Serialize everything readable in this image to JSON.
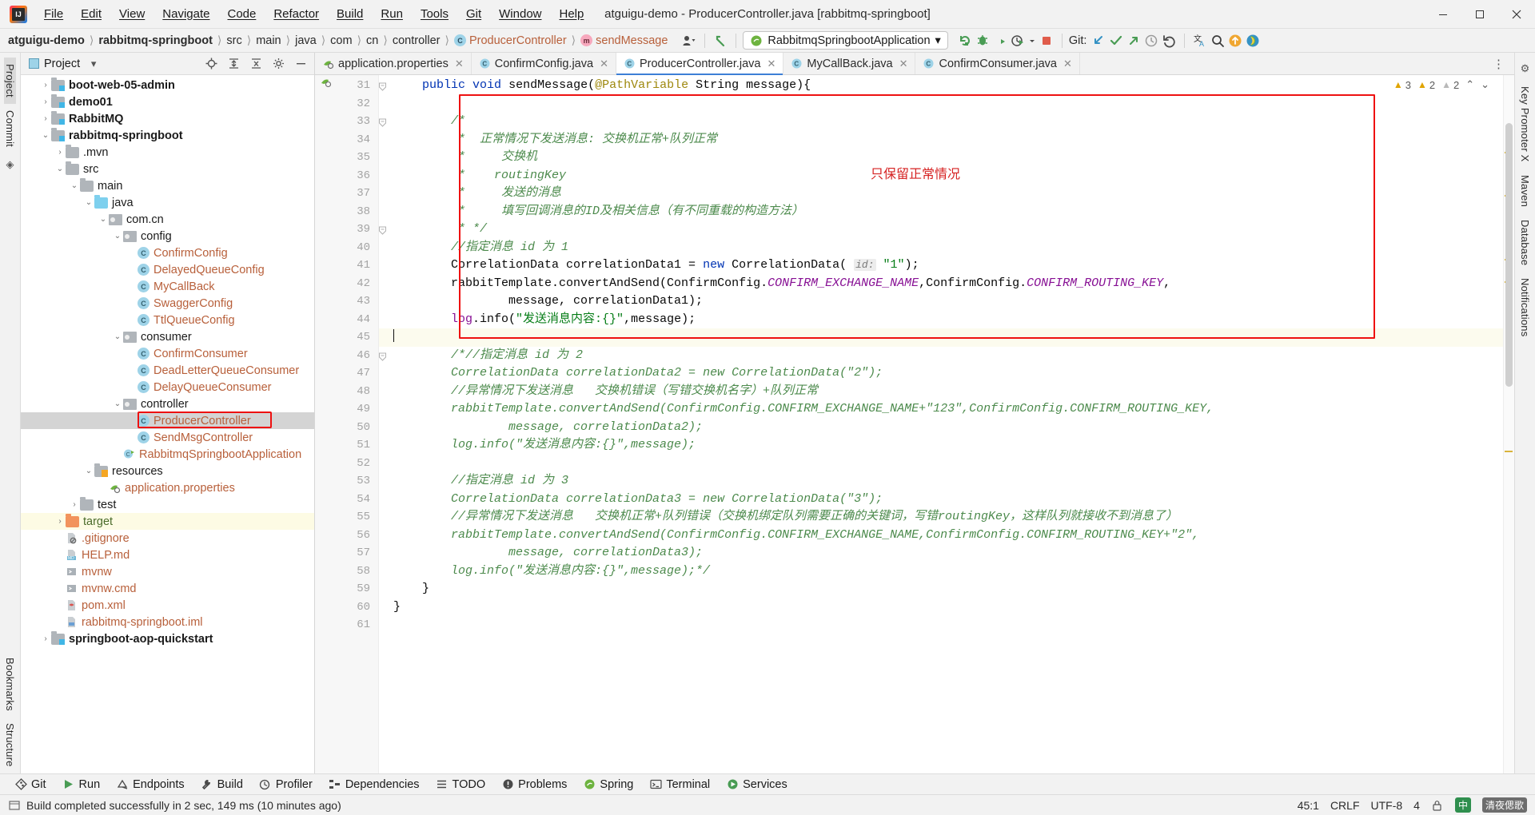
{
  "window": {
    "title": "atguigu-demo - ProducerController.java [rabbitmq-springboot]",
    "minimize": "—",
    "maximize": "☐",
    "close": "✕"
  },
  "menu": [
    {
      "label": "File",
      "mnemonic": "F"
    },
    {
      "label": "Edit",
      "mnemonic": "E"
    },
    {
      "label": "View",
      "mnemonic": "V"
    },
    {
      "label": "Navigate",
      "mnemonic": "N"
    },
    {
      "label": "Code",
      "mnemonic": "C"
    },
    {
      "label": "Refactor",
      "mnemonic": "R"
    },
    {
      "label": "Build",
      "mnemonic": "B"
    },
    {
      "label": "Run",
      "mnemonic": "u"
    },
    {
      "label": "Tools",
      "mnemonic": "T"
    },
    {
      "label": "Git",
      "mnemonic": "G"
    },
    {
      "label": "Window",
      "mnemonic": "W"
    },
    {
      "label": "Help",
      "mnemonic": "H"
    }
  ],
  "breadcrumb": [
    {
      "label": "atguigu-demo",
      "style": "bold"
    },
    {
      "label": "rabbitmq-springboot",
      "style": "bold"
    },
    {
      "label": "src",
      "style": "plain"
    },
    {
      "label": "main",
      "style": "plain"
    },
    {
      "label": "java",
      "style": "plain"
    },
    {
      "label": "com",
      "style": "plain"
    },
    {
      "label": "cn",
      "style": "plain"
    },
    {
      "label": "controller",
      "style": "plain"
    },
    {
      "label": "ProducerController",
      "style": "class"
    },
    {
      "label": "sendMessage",
      "style": "method"
    }
  ],
  "toolbar": {
    "run_config": "RabbitmqSpringbootApplication",
    "run_config_chevron": "▾",
    "git_label": "Git:",
    "icons": [
      "profile-selector-icon",
      "back-arrow-icon",
      "rerun-icon",
      "debug-icon",
      "run-with-coverage-icon",
      "profiler-icon",
      "stop-icon",
      "git-update-icon",
      "git-commit-icon",
      "git-push-icon",
      "git-history-icon",
      "git-rollback-icon",
      "translate-icon",
      "search-everywhere-icon",
      "updates-icon",
      "ide-feature-icon"
    ]
  },
  "left_rail": [
    {
      "label": "Project",
      "selected": true
    },
    {
      "label": "Commit",
      "selected": false
    },
    {
      "label": "Bookmarks",
      "selected": false
    },
    {
      "label": "Structure",
      "selected": false
    }
  ],
  "right_rail": [
    {
      "label": "Key Promoter X"
    },
    {
      "label": "Maven"
    },
    {
      "label": "Database"
    },
    {
      "label": "Notifications"
    }
  ],
  "project_panel": {
    "title": "Project",
    "chevron": "▾",
    "actions": [
      "locate-icon",
      "expand-all-icon",
      "collapse-all-icon",
      "settings-icon",
      "hide-icon"
    ]
  },
  "tree": [
    {
      "depth": 1,
      "arrow": "›",
      "icon": "module",
      "label": "boot-web-05-admin",
      "style": "bold"
    },
    {
      "depth": 1,
      "arrow": "›",
      "icon": "module",
      "label": "demo01",
      "style": "bold"
    },
    {
      "depth": 1,
      "arrow": "›",
      "icon": "module",
      "label": "RabbitMQ",
      "style": "bold"
    },
    {
      "depth": 1,
      "arrow": "⌄",
      "icon": "module",
      "label": "rabbitmq-springboot",
      "style": "bold"
    },
    {
      "depth": 2,
      "arrow": "›",
      "icon": "folder",
      "label": ".mvn",
      "style": "plain"
    },
    {
      "depth": 2,
      "arrow": "⌄",
      "icon": "folder",
      "label": "src",
      "style": "plain"
    },
    {
      "depth": 3,
      "arrow": "⌄",
      "icon": "folder",
      "label": "main",
      "style": "plain"
    },
    {
      "depth": 4,
      "arrow": "⌄",
      "icon": "source",
      "label": "java",
      "style": "plain"
    },
    {
      "depth": 5,
      "arrow": "⌄",
      "icon": "package",
      "label": "com.cn",
      "style": "plain"
    },
    {
      "depth": 6,
      "arrow": "⌄",
      "icon": "package",
      "label": "config",
      "style": "plain"
    },
    {
      "depth": 7,
      "arrow": "",
      "icon": "class",
      "label": "ConfirmConfig",
      "style": "orange"
    },
    {
      "depth": 7,
      "arrow": "",
      "icon": "class",
      "label": "DelayedQueueConfig",
      "style": "orange"
    },
    {
      "depth": 7,
      "arrow": "",
      "icon": "class",
      "label": "MyCallBack",
      "style": "orange"
    },
    {
      "depth": 7,
      "arrow": "",
      "icon": "class",
      "label": "SwaggerConfig",
      "style": "orange"
    },
    {
      "depth": 7,
      "arrow": "",
      "icon": "class",
      "label": "TtlQueueConfig",
      "style": "orange"
    },
    {
      "depth": 6,
      "arrow": "⌄",
      "icon": "package",
      "label": "consumer",
      "style": "plain"
    },
    {
      "depth": 7,
      "arrow": "",
      "icon": "class",
      "label": "ConfirmConsumer",
      "style": "orange"
    },
    {
      "depth": 7,
      "arrow": "",
      "icon": "class",
      "label": "DeadLetterQueueConsumer",
      "style": "orange"
    },
    {
      "depth": 7,
      "arrow": "",
      "icon": "class",
      "label": "DelayQueueConsumer",
      "style": "orange"
    },
    {
      "depth": 6,
      "arrow": "⌄",
      "icon": "package",
      "label": "controller",
      "style": "plain"
    },
    {
      "depth": 7,
      "arrow": "",
      "icon": "class",
      "label": "ProducerController",
      "style": "orange",
      "selected": true,
      "boxed": true
    },
    {
      "depth": 7,
      "arrow": "",
      "icon": "class",
      "label": "SendMsgController",
      "style": "orange"
    },
    {
      "depth": 6,
      "arrow": "",
      "icon": "spring",
      "label": "RabbitmqSpringbootApplication",
      "style": "orange"
    },
    {
      "depth": 4,
      "arrow": "⌄",
      "icon": "resources",
      "label": "resources",
      "style": "plain"
    },
    {
      "depth": 5,
      "arrow": "",
      "icon": "properties",
      "label": "application.properties",
      "style": "orange"
    },
    {
      "depth": 3,
      "arrow": "›",
      "icon": "folder",
      "label": "test",
      "style": "plain"
    },
    {
      "depth": 2,
      "arrow": "›",
      "icon": "target",
      "label": "target",
      "style": "green",
      "highlight": true
    },
    {
      "depth": 2,
      "arrow": "",
      "icon": "gitignore",
      "label": ".gitignore",
      "style": "orange"
    },
    {
      "depth": 2,
      "arrow": "",
      "icon": "md",
      "label": "HELP.md",
      "style": "orange"
    },
    {
      "depth": 2,
      "arrow": "",
      "icon": "sh",
      "label": "mvnw",
      "style": "orange"
    },
    {
      "depth": 2,
      "arrow": "",
      "icon": "sh",
      "label": "mvnw.cmd",
      "style": "orange"
    },
    {
      "depth": 2,
      "arrow": "",
      "icon": "maven",
      "label": "pom.xml",
      "style": "orange"
    },
    {
      "depth": 2,
      "arrow": "",
      "icon": "iml",
      "label": "rabbitmq-springboot.iml",
      "style": "orange"
    },
    {
      "depth": 1,
      "arrow": "›",
      "icon": "module",
      "label": "springboot-aop-quickstart",
      "style": "bold"
    }
  ],
  "tabs": [
    {
      "label": "application.properties",
      "icon": "properties-icon",
      "active": false
    },
    {
      "label": "ConfirmConfig.java",
      "icon": "class-icon",
      "active": false
    },
    {
      "label": "ProducerController.java",
      "icon": "class-icon",
      "active": true
    },
    {
      "label": "MyCallBack.java",
      "icon": "class-icon",
      "active": false
    },
    {
      "label": "ConfirmConsumer.java",
      "icon": "class-icon",
      "active": false
    }
  ],
  "inspection": {
    "errors": "3",
    "warnings": "2",
    "weak_warnings": "2",
    "up_arrow": "⌃",
    "down_arrow": "⌄"
  },
  "annotation": {
    "text": "只保留正常情况",
    "color": "#d62222"
  },
  "code": {
    "first_line": 31,
    "lines": [
      {
        "n": 31,
        "segments": [
          {
            "t": "    ",
            "c": ""
          },
          {
            "t": "public",
            "c": "k"
          },
          {
            "t": " ",
            "c": ""
          },
          {
            "t": "void",
            "c": "k"
          },
          {
            "t": " sendMessage(",
            "c": ""
          },
          {
            "t": "@PathVariable",
            "c": "ann"
          },
          {
            "t": " String message){",
            "c": ""
          }
        ]
      },
      {
        "n": 32,
        "segments": []
      },
      {
        "n": 33,
        "segments": [
          {
            "t": "        /*",
            "c": "cmt"
          }
        ]
      },
      {
        "n": 34,
        "segments": [
          {
            "t": "         *  正常情况下发送消息: 交换机正常+队列正常",
            "c": "cmt"
          }
        ]
      },
      {
        "n": 35,
        "segments": [
          {
            "t": "         *     交换机",
            "c": "cmt"
          }
        ]
      },
      {
        "n": 36,
        "segments": [
          {
            "t": "         *    routingKey",
            "c": "cmt"
          }
        ]
      },
      {
        "n": 37,
        "segments": [
          {
            "t": "         *     发送的消息",
            "c": "cmt"
          }
        ]
      },
      {
        "n": 38,
        "segments": [
          {
            "t": "         *     填写回调消息的ID及相关信息（有不同重载的构造方法）",
            "c": "cmt"
          }
        ]
      },
      {
        "n": 39,
        "segments": [
          {
            "t": "         * */",
            "c": "cmt"
          }
        ]
      },
      {
        "n": 40,
        "segments": [
          {
            "t": "        //指定消息 id 为 1",
            "c": "cmt"
          }
        ]
      },
      {
        "n": 41,
        "segments": [
          {
            "t": "        CorrelationData correlationData1 = ",
            "c": ""
          },
          {
            "t": "new",
            "c": "k"
          },
          {
            "t": " CorrelationData( ",
            "c": ""
          },
          {
            "t": "id:",
            "c": "hint"
          },
          {
            "t": " ",
            "c": ""
          },
          {
            "t": "\"1\"",
            "c": "str"
          },
          {
            "t": ");",
            "c": ""
          }
        ]
      },
      {
        "n": 42,
        "segments": [
          {
            "t": "        rabbitTemplate.convertAndSend(ConfirmConfig.",
            "c": ""
          },
          {
            "t": "CONFIRM_EXCHANGE_NAME",
            "c": "cn"
          },
          {
            "t": ",ConfirmConfig.",
            "c": ""
          },
          {
            "t": "CONFIRM_ROUTING_KEY",
            "c": "cn"
          },
          {
            "t": ",",
            "c": ""
          }
        ]
      },
      {
        "n": 43,
        "segments": [
          {
            "t": "                message, correlationData1);",
            "c": ""
          }
        ]
      },
      {
        "n": 44,
        "segments": [
          {
            "t": "        log",
            "c": "fld"
          },
          {
            "t": ".info(",
            "c": ""
          },
          {
            "t": "\"发送消息内容:{}\"",
            "c": "str"
          },
          {
            "t": ",message);",
            "c": ""
          }
        ]
      },
      {
        "n": 45,
        "segments": [],
        "caret": true,
        "highlight": true
      },
      {
        "n": 46,
        "segments": [
          {
            "t": "        /*//指定消息 id 为 2",
            "c": "cmt"
          }
        ]
      },
      {
        "n": 47,
        "segments": [
          {
            "t": "        CorrelationData correlationData2 = new CorrelationData(\"2\");",
            "c": "cmt"
          }
        ]
      },
      {
        "n": 48,
        "segments": [
          {
            "t": "        //异常情况下发送消息   交换机错误（写错交换机名字）+队列正常",
            "c": "cmt"
          }
        ]
      },
      {
        "n": 49,
        "segments": [
          {
            "t": "        rabbitTemplate.convertAndSend(ConfirmConfig.CONFIRM_EXCHANGE_NAME+\"123\",ConfirmConfig.CONFIRM_ROUTING_KEY,",
            "c": "cmt"
          }
        ]
      },
      {
        "n": 50,
        "segments": [
          {
            "t": "                message, correlationData2);",
            "c": "cmt"
          }
        ]
      },
      {
        "n": 51,
        "segments": [
          {
            "t": "        log.info(\"发送消息内容:{}\",message);",
            "c": "cmt"
          }
        ]
      },
      {
        "n": 52,
        "segments": []
      },
      {
        "n": 53,
        "segments": [
          {
            "t": "        //指定消息 id 为 3",
            "c": "cmt"
          }
        ]
      },
      {
        "n": 54,
        "segments": [
          {
            "t": "        CorrelationData correlationData3 = new CorrelationData(\"3\");",
            "c": "cmt"
          }
        ]
      },
      {
        "n": 55,
        "segments": [
          {
            "t": "        //异常情况下发送消息   交换机正常+队列错误（交换机绑定队列需要正确的关键词，写错routingKey，这样队列就接收不到消息了）",
            "c": "cmt"
          }
        ]
      },
      {
        "n": 56,
        "segments": [
          {
            "t": "        rabbitTemplate.convertAndSend(ConfirmConfig.CONFIRM_EXCHANGE_NAME,ConfirmConfig.CONFIRM_ROUTING_KEY+\"2\",",
            "c": "cmt"
          }
        ]
      },
      {
        "n": 57,
        "segments": [
          {
            "t": "                message, correlationData3);",
            "c": "cmt"
          }
        ]
      },
      {
        "n": 58,
        "segments": [
          {
            "t": "        log.info(\"发送消息内容:{}\",message);*/",
            "c": "cmt"
          }
        ]
      },
      {
        "n": 59,
        "segments": [
          {
            "t": "    }",
            "c": ""
          }
        ]
      },
      {
        "n": 60,
        "segments": [
          {
            "t": "}",
            "c": ""
          }
        ]
      },
      {
        "n": 61,
        "segments": []
      }
    ]
  },
  "tool_windows": [
    {
      "label": "Git",
      "icon": "git-icon"
    },
    {
      "label": "Run",
      "icon": "run-icon"
    },
    {
      "label": "Endpoints",
      "icon": "endpoints-icon"
    },
    {
      "label": "Build",
      "icon": "build-icon"
    },
    {
      "label": "Profiler",
      "icon": "profiler-icon"
    },
    {
      "label": "Dependencies",
      "icon": "dependencies-icon"
    },
    {
      "label": "TODO",
      "icon": "todo-icon"
    },
    {
      "label": "Problems",
      "icon": "problems-icon"
    },
    {
      "label": "Spring",
      "icon": "spring-icon"
    },
    {
      "label": "Terminal",
      "icon": "terminal-icon"
    },
    {
      "label": "Services",
      "icon": "services-icon"
    }
  ],
  "status": {
    "message": "Build completed successfully in 2 sec, 149 ms (10 minutes ago)",
    "caret_position": "45:1",
    "line_separator": "CRLF",
    "encoding": "UTF-8",
    "indent": "4",
    "ime_cn": "中",
    "ime_label": "清夜偲歌"
  }
}
